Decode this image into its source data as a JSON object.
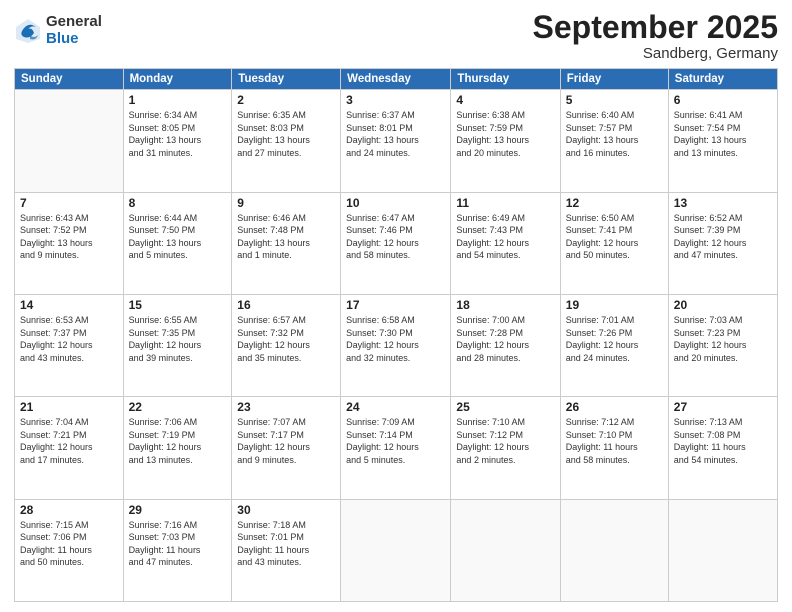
{
  "logo": {
    "general": "General",
    "blue": "Blue"
  },
  "title": "September 2025",
  "subtitle": "Sandberg, Germany",
  "days_header": [
    "Sunday",
    "Monday",
    "Tuesday",
    "Wednesday",
    "Thursday",
    "Friday",
    "Saturday"
  ],
  "weeks": [
    [
      {
        "day": "",
        "info": ""
      },
      {
        "day": "1",
        "info": "Sunrise: 6:34 AM\nSunset: 8:05 PM\nDaylight: 13 hours\nand 31 minutes."
      },
      {
        "day": "2",
        "info": "Sunrise: 6:35 AM\nSunset: 8:03 PM\nDaylight: 13 hours\nand 27 minutes."
      },
      {
        "day": "3",
        "info": "Sunrise: 6:37 AM\nSunset: 8:01 PM\nDaylight: 13 hours\nand 24 minutes."
      },
      {
        "day": "4",
        "info": "Sunrise: 6:38 AM\nSunset: 7:59 PM\nDaylight: 13 hours\nand 20 minutes."
      },
      {
        "day": "5",
        "info": "Sunrise: 6:40 AM\nSunset: 7:57 PM\nDaylight: 13 hours\nand 16 minutes."
      },
      {
        "day": "6",
        "info": "Sunrise: 6:41 AM\nSunset: 7:54 PM\nDaylight: 13 hours\nand 13 minutes."
      }
    ],
    [
      {
        "day": "7",
        "info": "Sunrise: 6:43 AM\nSunset: 7:52 PM\nDaylight: 13 hours\nand 9 minutes."
      },
      {
        "day": "8",
        "info": "Sunrise: 6:44 AM\nSunset: 7:50 PM\nDaylight: 13 hours\nand 5 minutes."
      },
      {
        "day": "9",
        "info": "Sunrise: 6:46 AM\nSunset: 7:48 PM\nDaylight: 13 hours\nand 1 minute."
      },
      {
        "day": "10",
        "info": "Sunrise: 6:47 AM\nSunset: 7:46 PM\nDaylight: 12 hours\nand 58 minutes."
      },
      {
        "day": "11",
        "info": "Sunrise: 6:49 AM\nSunset: 7:43 PM\nDaylight: 12 hours\nand 54 minutes."
      },
      {
        "day": "12",
        "info": "Sunrise: 6:50 AM\nSunset: 7:41 PM\nDaylight: 12 hours\nand 50 minutes."
      },
      {
        "day": "13",
        "info": "Sunrise: 6:52 AM\nSunset: 7:39 PM\nDaylight: 12 hours\nand 47 minutes."
      }
    ],
    [
      {
        "day": "14",
        "info": "Sunrise: 6:53 AM\nSunset: 7:37 PM\nDaylight: 12 hours\nand 43 minutes."
      },
      {
        "day": "15",
        "info": "Sunrise: 6:55 AM\nSunset: 7:35 PM\nDaylight: 12 hours\nand 39 minutes."
      },
      {
        "day": "16",
        "info": "Sunrise: 6:57 AM\nSunset: 7:32 PM\nDaylight: 12 hours\nand 35 minutes."
      },
      {
        "day": "17",
        "info": "Sunrise: 6:58 AM\nSunset: 7:30 PM\nDaylight: 12 hours\nand 32 minutes."
      },
      {
        "day": "18",
        "info": "Sunrise: 7:00 AM\nSunset: 7:28 PM\nDaylight: 12 hours\nand 28 minutes."
      },
      {
        "day": "19",
        "info": "Sunrise: 7:01 AM\nSunset: 7:26 PM\nDaylight: 12 hours\nand 24 minutes."
      },
      {
        "day": "20",
        "info": "Sunrise: 7:03 AM\nSunset: 7:23 PM\nDaylight: 12 hours\nand 20 minutes."
      }
    ],
    [
      {
        "day": "21",
        "info": "Sunrise: 7:04 AM\nSunset: 7:21 PM\nDaylight: 12 hours\nand 17 minutes."
      },
      {
        "day": "22",
        "info": "Sunrise: 7:06 AM\nSunset: 7:19 PM\nDaylight: 12 hours\nand 13 minutes."
      },
      {
        "day": "23",
        "info": "Sunrise: 7:07 AM\nSunset: 7:17 PM\nDaylight: 12 hours\nand 9 minutes."
      },
      {
        "day": "24",
        "info": "Sunrise: 7:09 AM\nSunset: 7:14 PM\nDaylight: 12 hours\nand 5 minutes."
      },
      {
        "day": "25",
        "info": "Sunrise: 7:10 AM\nSunset: 7:12 PM\nDaylight: 12 hours\nand 2 minutes."
      },
      {
        "day": "26",
        "info": "Sunrise: 7:12 AM\nSunset: 7:10 PM\nDaylight: 11 hours\nand 58 minutes."
      },
      {
        "day": "27",
        "info": "Sunrise: 7:13 AM\nSunset: 7:08 PM\nDaylight: 11 hours\nand 54 minutes."
      }
    ],
    [
      {
        "day": "28",
        "info": "Sunrise: 7:15 AM\nSunset: 7:06 PM\nDaylight: 11 hours\nand 50 minutes."
      },
      {
        "day": "29",
        "info": "Sunrise: 7:16 AM\nSunset: 7:03 PM\nDaylight: 11 hours\nand 47 minutes."
      },
      {
        "day": "30",
        "info": "Sunrise: 7:18 AM\nSunset: 7:01 PM\nDaylight: 11 hours\nand 43 minutes."
      },
      {
        "day": "",
        "info": ""
      },
      {
        "day": "",
        "info": ""
      },
      {
        "day": "",
        "info": ""
      },
      {
        "day": "",
        "info": ""
      }
    ]
  ]
}
